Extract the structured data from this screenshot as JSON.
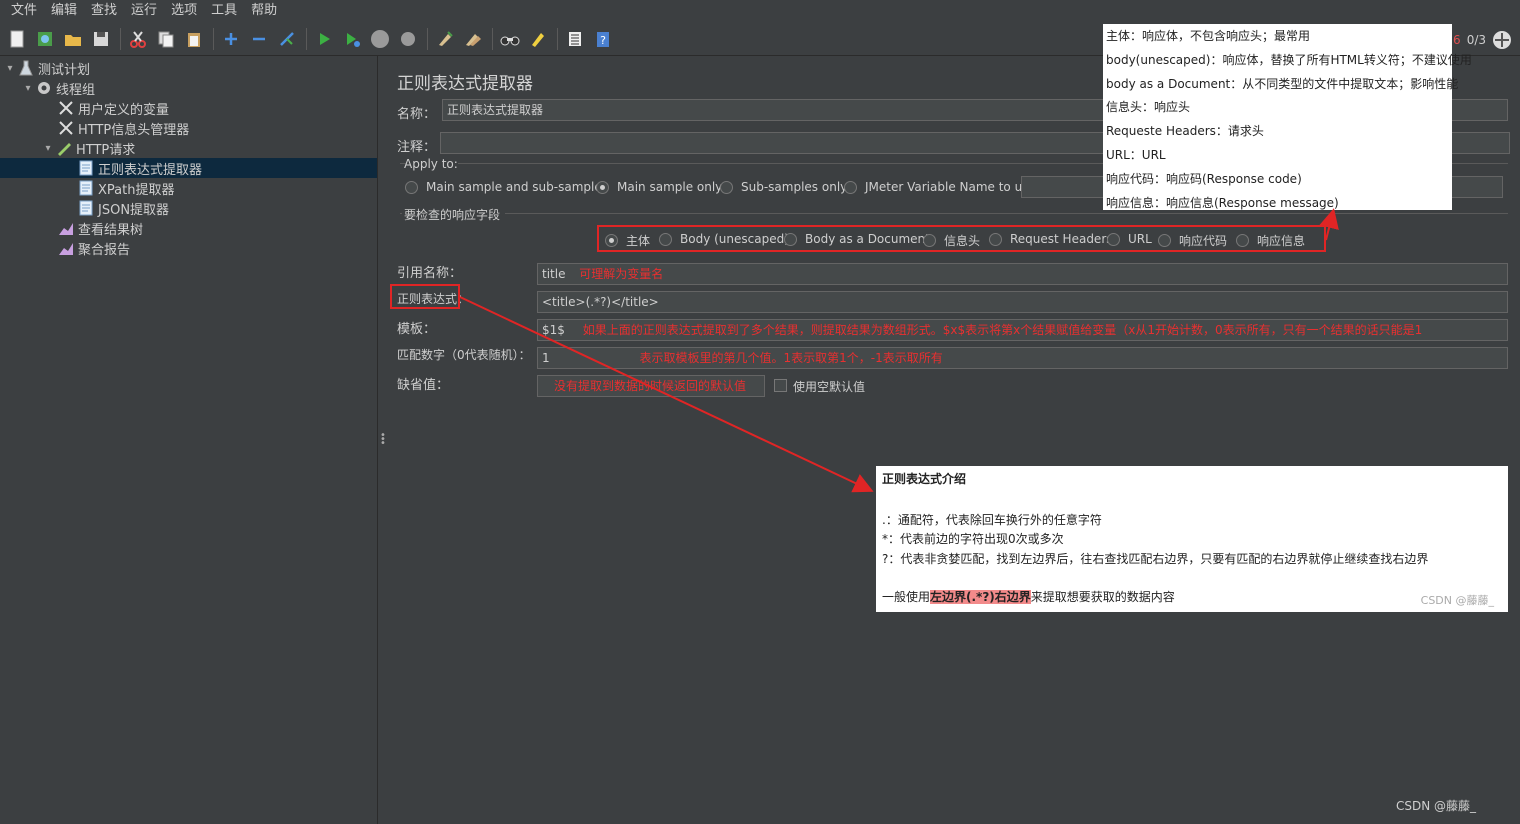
{
  "menu": [
    "文件",
    "编辑",
    "查找",
    "运行",
    "选项",
    "工具",
    "帮助"
  ],
  "toolbar_icons": [
    "new-icon",
    "templates-icon",
    "open-icon",
    "save-icon",
    "cut-icon",
    "copy-icon",
    "paste-icon",
    "expand-icon",
    "collapse-icon",
    "toggle-icon",
    "start-icon",
    "start-no-pause-icon",
    "stop-icon",
    "shutdown-icon",
    "clear-icon",
    "clear-all-icon",
    "search-icon",
    "reset-search-icon",
    "function-helper-icon",
    "help-icon"
  ],
  "status": {
    "warn_count": "6",
    "threads": "0/3"
  },
  "tree": [
    {
      "label": "测试计划",
      "icon": "flask-icon"
    },
    {
      "label": "线程组",
      "icon": "gear-icon"
    },
    {
      "label": "用户定义的变量",
      "icon": "tools-icon"
    },
    {
      "label": "HTTP信息头管理器",
      "icon": "tools-icon"
    },
    {
      "label": "HTTP请求",
      "icon": "pen-icon"
    },
    {
      "label": "正则表达式提取器",
      "icon": "doc-icon"
    },
    {
      "label": "XPath提取器",
      "icon": "doc-icon"
    },
    {
      "label": "JSON提取器",
      "icon": "doc-icon"
    },
    {
      "label": "查看结果树",
      "icon": "chart-icon"
    },
    {
      "label": "聚合报告",
      "icon": "chart-icon"
    }
  ],
  "panel": {
    "title": "正则表达式提取器",
    "name_label": "名称：",
    "name_value": "正则表达式提取器",
    "comment_label": "注释：",
    "apply_to_label": "Apply to:",
    "apply_options": [
      "Main sample and sub-samples",
      "Main sample only",
      "Sub-samples only",
      "JMeter Variable Name to use"
    ],
    "field_label": "要检查的响应字段",
    "field_options": [
      "主体",
      "Body (unescaped)",
      "Body as a Document",
      "信息头",
      "Request Headers",
      "URL",
      "响应代码",
      "响应信息"
    ],
    "ref_label": "引用名称：",
    "ref_value": "title",
    "ref_note": "可理解为变量名",
    "regex_label": "正则表达式：",
    "regex_value": "<title>(.*?)</title>",
    "template_label": "模板：",
    "template_value": "$1$",
    "template_note": "如果上面的正则表达式提取到了多个结果，则提取结果为数组形式。$x$表示将第x个结果赋值给变量（x从1开始计数，0表示所有，只有一个结果的话只能是1",
    "match_label": "匹配数字（0代表随机）：",
    "match_value": "1",
    "match_note": "表示取模板里的第几个值。1表示取第1个，-1表示取所有",
    "default_label": "缺省值：",
    "default_note": "没有提取到数据的时候返回的默认值",
    "empty_default_label": "使用空默认值"
  },
  "field_popup": [
    "主体：响应体，不包含响应头；最常用",
    "body(unescaped)：响应体，替换了所有HTML转义符；不建议使用",
    "body as a Document：从不同类型的文件中提取文本；影响性能",
    "信息头：响应头",
    "Requeste Headers：请求头",
    "URL：URL",
    "响应代码：响应码(Response code)",
    "响应信息：响应信息(Response message)"
  ],
  "regex_popup": {
    "title": "正则表达式介绍",
    "lines": [
      ".：通配符，代表除回车换行外的任意字符",
      "*：代表前边的字符出现0次或多次",
      "?：代表非贪婪匹配，找到左边界后，往右查找匹配右边界，只要有匹配的右边界就停止继续查找右边界"
    ],
    "usage_pre": "一般使用",
    "usage_hl": "左边界(.*?)右边界",
    "usage_post": "来提取想要获取的数据内容",
    "watermark": "CSDN @藤藤_"
  },
  "watermark": "CSDN @藤藤_"
}
